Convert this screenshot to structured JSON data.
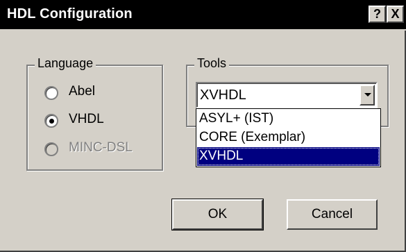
{
  "window": {
    "title": "HDL Configuration",
    "help_glyph": "?",
    "close_glyph": "X"
  },
  "language": {
    "label": "Language",
    "options": [
      {
        "label": "Abel",
        "checked": false,
        "enabled": true
      },
      {
        "label": "VHDL",
        "checked": true,
        "enabled": true
      },
      {
        "label": "MINC-DSL",
        "checked": false,
        "enabled": false
      }
    ]
  },
  "tools": {
    "label": "Tools",
    "selected_value": "XVHDL",
    "options": [
      "ASYL+ (IST)",
      "CORE (Exemplar)",
      "XVHDL"
    ],
    "highlighted_option": "XVHDL"
  },
  "buttons": {
    "ok_label": "OK",
    "cancel_label": "Cancel"
  },
  "colors": {
    "titlebar": "#000000",
    "face": "#d4d0c8",
    "selection": "#000080"
  }
}
